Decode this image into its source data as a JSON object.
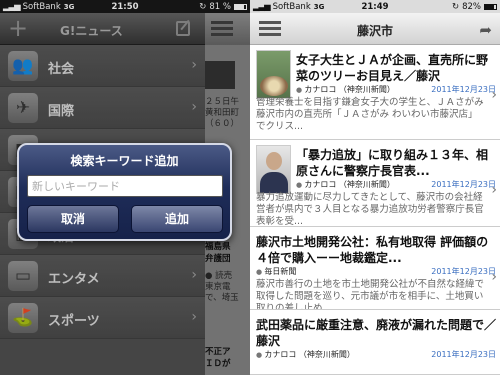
{
  "left": {
    "status": {
      "carrier": "SoftBank",
      "network": "3G",
      "time": "21:50",
      "battery": "81 %",
      "battery_level": 0.81
    },
    "navbar": {
      "title": "G!ニュース",
      "add_icon": "plus-icon",
      "edit_icon": "edit-icon"
    },
    "categories": [
      {
        "label": "社会",
        "icon": "people-icon"
      },
      {
        "label": "国際",
        "icon": "airplane-icon"
      },
      {
        "label": "",
        "icon": "category-icon"
      },
      {
        "label": "",
        "icon": "category-icon"
      },
      {
        "label": "政治",
        "icon": "building-icon"
      },
      {
        "label": "エンタメ",
        "icon": "tv-icon"
      },
      {
        "label": "スポーツ",
        "icon": "golf-icon"
      }
    ],
    "peek": {
      "snippet_lines": [
        "２５日午",
        "黄和田町",
        "（６０）"
      ],
      "title_lines": [
        "福島県",
        "弁護団"
      ],
      "snippet2_lines": [
        "● 読売",
        "東京電",
        "で、埼玉"
      ],
      "title2_lines": [
        "不正ア",
        "ＩＤが"
      ]
    },
    "dialog": {
      "title": "検索キーワード追加",
      "placeholder": "新しいキーワード",
      "cancel_label": "取消",
      "add_label": "追加"
    }
  },
  "right": {
    "status": {
      "carrier": "SoftBank",
      "network": "3G",
      "time": "21:49",
      "battery": "82%",
      "battery_level": 0.82
    },
    "navbar": {
      "title": "藤沢市",
      "menu_icon": "menu-icon",
      "share_icon": "share-icon"
    },
    "articles": [
      {
        "title": "女子大生とＪＡが企画、直売所に野菜のツリーお目見え／藤沢",
        "source": "カナロコ （神奈川新聞）",
        "date": "2011年12月23日",
        "snippet": "管理栄養士を目指す鎌倉女子大の学生と、ＪＡさがみ藤沢市内の直売所「ＪＡさがみ わいわい市藤沢店」でクリス..."
      },
      {
        "title": "「暴力追放」に取り組み１３年、相原さんに警察庁長官表...",
        "source": "カナロコ （神奈川新聞）",
        "date": "2011年12月23日",
        "snippet": "暴力追放運動に尽力してきたとして、藤沢市の会社経営者が県内で３人目となる暴力追放功労者警察庁長官表彰を受..."
      },
      {
        "title": "藤沢市土地開発公社：私有地取得 評価額の４倍で購入ーー地裁鑑定...",
        "source": "毎日新聞",
        "date": "2011年12月23日",
        "snippet": "藤沢市善行の土地を市土地開発公社が不自然な経緯で取得した問題を巡り、元市議が市を相手に、土地買い取りの差し止め..."
      },
      {
        "title": "武田薬品に厳重注意、廃液が漏れた問題で／藤沢",
        "source": "カナロコ （神奈川新聞）",
        "date": "2011年12月23日"
      }
    ]
  }
}
